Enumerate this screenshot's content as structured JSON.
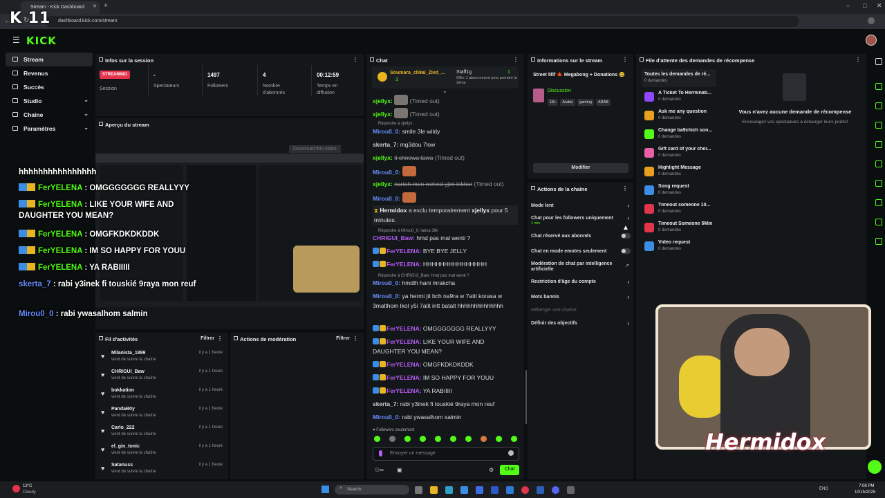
{
  "browser": {
    "tab_title": "Stream - Kick Dashboard",
    "url": "dashboard.kick.com/stream"
  },
  "app": {
    "logo": "KICK",
    "logo_small": "K 11"
  },
  "sidebar": {
    "items": [
      {
        "label": "Stream",
        "icon": "stream-icon",
        "active": true
      },
      {
        "label": "Revenus",
        "icon": "revenue-icon"
      },
      {
        "label": "Succès",
        "icon": "trophy-icon"
      },
      {
        "label": "Studio",
        "icon": "studio-icon",
        "chevron": true
      },
      {
        "label": "Chaîne",
        "icon": "channel-icon",
        "chevron": true
      },
      {
        "label": "Paramètres",
        "icon": "gear-icon",
        "chevron": true
      }
    ]
  },
  "session": {
    "title": "Infos sur la session",
    "status_badge": "STREAMING",
    "status_label": "Session",
    "viewers_value": "-",
    "viewers_label": "Spectateurs",
    "followers_value": "1497",
    "followers_label": "Followers",
    "subs_value": "4",
    "subs_label": "Nombre d'abonnés",
    "time_value": "00:12:59",
    "time_label": "Temps en diffusion"
  },
  "preview": {
    "title": "Aperçu du stream",
    "download_label": "Download this video"
  },
  "overlay_chat": [
    {
      "user": "",
      "text": "hhhhhhhhhhhhhhhh"
    },
    {
      "user": "FerYELENA",
      "text": " : OMGGGGGGG REALLYYY"
    },
    {
      "user": "FerYELENA",
      "text": " : LIKE YOUR WIFE AND DAUGHTER YOU MEAN?"
    },
    {
      "user": "FerYELENA",
      "text": " : OMGFKDKDKDDK"
    },
    {
      "user": "FerYELENA",
      "text": " : IM SO HAPPY FOR YOUU"
    },
    {
      "user": "FerYELENA",
      "text": " : YA RABIIIII"
    },
    {
      "user": "skerta_7",
      "text": " : rabi y3inek fi touskié 9raya mon reuf"
    },
    {
      "user": "Mirou0_0",
      "text": " : rabi ywasalhom salmin"
    }
  ],
  "activity": {
    "title": "Fil d'activités",
    "filter": "Filtrer",
    "rows": [
      {
        "name": "Milanista_1899",
        "sub": "vient de suivre la chaîne",
        "time": "il y a 1 heure"
      },
      {
        "name": "CHRIGUI_Baw",
        "sub": "vient de suivre la chaîne",
        "time": "il y a 1 heure"
      },
      {
        "name": "bokkation",
        "sub": "vient de suivre la chaîne",
        "time": "il y a 1 heure"
      },
      {
        "name": "PandaB0y",
        "sub": "vient de suivre la chaîne",
        "time": "il y a 1 heure"
      },
      {
        "name": "Carlo_222",
        "sub": "vient de suivre la chaîne",
        "time": "il y a 1 heure"
      },
      {
        "name": "el_gin_tonic",
        "sub": "vient de suivre la chaîne",
        "time": "il y a 1 heure"
      },
      {
        "name": "Satanuss",
        "sub": "vient de suivre la chaîne",
        "time": "il y a 1 heure"
      }
    ]
  },
  "moderation": {
    "title": "Actions de modération",
    "filter": "Filtrer"
  },
  "chat": {
    "title": "Chat",
    "pinned_user": "Soumara_ch9ai_Zied_...",
    "pinned_count": "3",
    "pinned_staff": "Staff1g",
    "pinned_count2": "1",
    "pinned_offer": "Offrir 1 abonnement pour prendre la 3ème",
    "reply1": "Répondre à xjellyx:",
    "reply2": "Répondre à Mirou0_0: labsa 3lik",
    "reply3": "Répondre à CHRIGUI_Baw: hmd pas mal wenti ?",
    "followers_only": "Followers seulement",
    "input_placeholder": "Envoyer un message",
    "send_label": "Chat",
    "m1_user": "xjellyx:",
    "m1_text": "(Timed out)",
    "m2_user": "xjellyx:",
    "m2_text": "(Timed out)",
    "m3_user": "Mirou0_0:",
    "m3_text": "smile 3le wildy",
    "m4_user": "skerta_7:",
    "m4_text": "mg3dou 7low",
    "m5_user": "xjellyx:",
    "m5_strike": "ti chnowa tawa",
    "m5_text": "(Timed out)",
    "m6_user": "Mirou0_0:",
    "m7_user": "xjellyx:",
    "m7_strike": "narteh men wehed yjini lekher",
    "m7_text": "(Timed out)",
    "m8_user": "Mirou0_0:",
    "m9_user": "Hermidox",
    "m9_text": "a exclu temporairement",
    "m9_target": "xjellyx",
    "m9_tail": "pour 5 minutes.",
    "m10_user": "CHRIGUI_Baw:",
    "m10_text": "hmd pas mal wenti ?",
    "m11_user": "FerYELENA:",
    "m11_text": "BYE BYE JELLY",
    "m12_user": "FerYELENA:",
    "m12_text": "HHHHHHHHHHHHHHH",
    "m13_user": "Mirou0_0:",
    "m13_text": "hmdlh hani mrakcha",
    "m14_user": "Mirou0_0:",
    "m14_text": "ya hermi jit bch na9ra w 7atit korasa w 3malthom lkol y5i 7alit intt batalt hhhhhhhhhhhhhh",
    "m15_user": "FerYELENA:",
    "m15_text": "OMGGGGGGG REALLYYY",
    "m16_user": "FerYELENA:",
    "m16_text": "LIKE YOUR WIFE AND DAUGHTER YOU MEAN?",
    "m17_user": "FerYELENA:",
    "m17_text": "OMGFKDKDKDDK",
    "m18_user": "FerYELENA:",
    "m18_text": "IM SO HAPPY FOR YOUU",
    "m19_user": "FerYELENA:",
    "m19_text": "YA RABIIIII",
    "m20_user": "skerta_7:",
    "m20_text": "rabi y3inek fi touskié 9raya mon reuf",
    "m21_user": "Mirou0_0:",
    "m21_text": "rabi ywasalhom salmin"
  },
  "stream_info": {
    "title": "Informations sur le stream",
    "stream_title": "Street 5fif 🍁 Megabong + Donations 😂",
    "category": "Discussion",
    "tags": [
      "18+",
      "Arabic",
      "gaming",
      "ARAB"
    ],
    "edit_button": "Modifier"
  },
  "channel_actions": {
    "title": "Actions de la chaîne",
    "slow_mode": "Mode lent",
    "followers_only": "Chat pour les followers uniquement",
    "followers_only_sub": "1 min",
    "subs_only": "Chat réservé aux abonnés",
    "emotes_only": "Chat en mode emotes seulement",
    "ai_mod": "Modération de chat par intelligence artificielle",
    "age_restriction": "Restriction d'âge du compte",
    "banned_words": "Mots bannis",
    "host": "Héberger une chaîne",
    "goals": "Définir des objectifs"
  },
  "rewards": {
    "title": "File d'attente des demandes de récompense",
    "all_label": "Toutes les demandes de ré...",
    "all_count": "0 demandes",
    "empty_title": "Vous n'avez aucune demande de récompense",
    "empty_sub": "Encouragez vos spectateurs à échanger leurs points!",
    "items": [
      {
        "name": "A Ticket To Herminati...",
        "count": "0 demandes",
        "color": "#9146ff"
      },
      {
        "name": "Ask me any question",
        "count": "0 demandes",
        "color": "#e8a11c"
      },
      {
        "name": "Change ba9chich son...",
        "count": "0 demandes",
        "color": "#53fc18"
      },
      {
        "name": "Gift card of your choi...",
        "count": "0 demandes",
        "color": "#e85fa8"
      },
      {
        "name": "Highlight Message",
        "count": "0 demandes",
        "color": "#e8a11c"
      },
      {
        "name": "Song request",
        "count": "0 demandes",
        "color": "#3c8de6"
      },
      {
        "name": "Timeout someone 10...",
        "count": "0 demandes",
        "color": "#e2344b"
      },
      {
        "name": "Timeout Someone 5Min",
        "count": "0 demandes",
        "color": "#e2344b"
      },
      {
        "name": "Video request",
        "count": "0 demandes",
        "color": "#3c8de6"
      }
    ]
  },
  "webcam": {
    "name": "Hermidox"
  },
  "taskbar": {
    "weather_temp": "13°C",
    "weather_label": "Cloudy",
    "search_placeholder": "Search",
    "lang": "ENG",
    "time": "7:08 PM",
    "date": "10/15/2025"
  },
  "colors": {
    "accent": "#53fc18",
    "panel": "#14171a",
    "background": "#0b0e0f"
  }
}
